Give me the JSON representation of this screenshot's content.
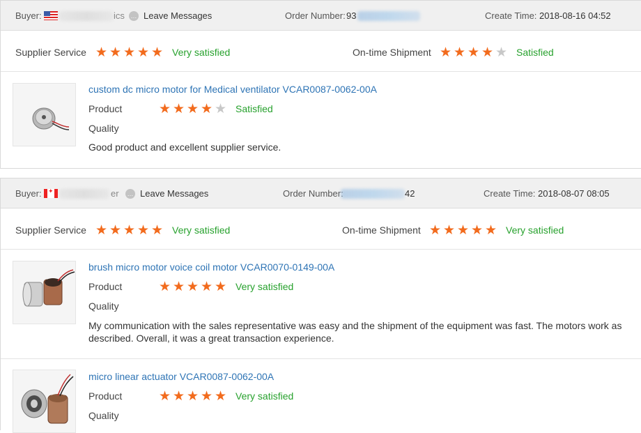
{
  "orders": [
    {
      "buyer_label": "Buyer:",
      "buyer_name_visible": "ics",
      "leave_messages": "Leave Messages",
      "order_number_label": "Order Number:",
      "order_number_visible": "93",
      "create_time_label": "Create Time:",
      "create_time": "2018-08-16 04:52",
      "supplier_service": {
        "label": "Supplier Service",
        "stars": 5,
        "text": "Very satisfied"
      },
      "ontime_shipment": {
        "label": "On-time Shipment",
        "stars": 4,
        "text": "Satisfied"
      },
      "items": [
        {
          "title": "custom dc micro motor for Medical ventilator VCAR0087-0062-00A",
          "product_label": "Product",
          "product_stars": 4,
          "product_text": "Satisfied",
          "quality_label": "Quality",
          "comment": "Good product and excellent supplier service."
        }
      ]
    },
    {
      "buyer_label": "Buyer:",
      "buyer_name_visible": "er",
      "leave_messages": "Leave Messages",
      "order_number_label": "Order Number:",
      "order_number_visible": "42",
      "create_time_label": "Create Time:",
      "create_time": "2018-08-07 08:05",
      "supplier_service": {
        "label": "Supplier Service",
        "stars": 5,
        "text": "Very satisfied"
      },
      "ontime_shipment": {
        "label": "On-time Shipment",
        "stars": 5,
        "text": "Very satisfied"
      },
      "items": [
        {
          "title": "brush micro motor voice coil motor VCAR0070-0149-00A",
          "product_label": "Product",
          "product_stars": 5,
          "product_text": "Very satisfied",
          "quality_label": "Quality",
          "comment": "My communication with the sales representative was easy and the shipment of the equipment was fast. The motors work as described. Overall, it was a great transaction experience."
        },
        {
          "title": "micro linear actuator VCAR0087-0062-00A",
          "product_label": "Product",
          "product_stars": 5,
          "product_text": "Very satisfied",
          "quality_label": "Quality",
          "comment": ""
        }
      ]
    }
  ],
  "icons": {
    "star": "star-icon",
    "chat": "chat-icon",
    "flag_1": "us-flag-icon",
    "flag_2": "canada-flag-icon"
  },
  "colors": {
    "star_on": "#f26b1d",
    "star_off": "#c8c8c8",
    "satisfied_text": "#27a12d",
    "link": "#2e74b5",
    "header_bg": "#f0f0f0"
  }
}
